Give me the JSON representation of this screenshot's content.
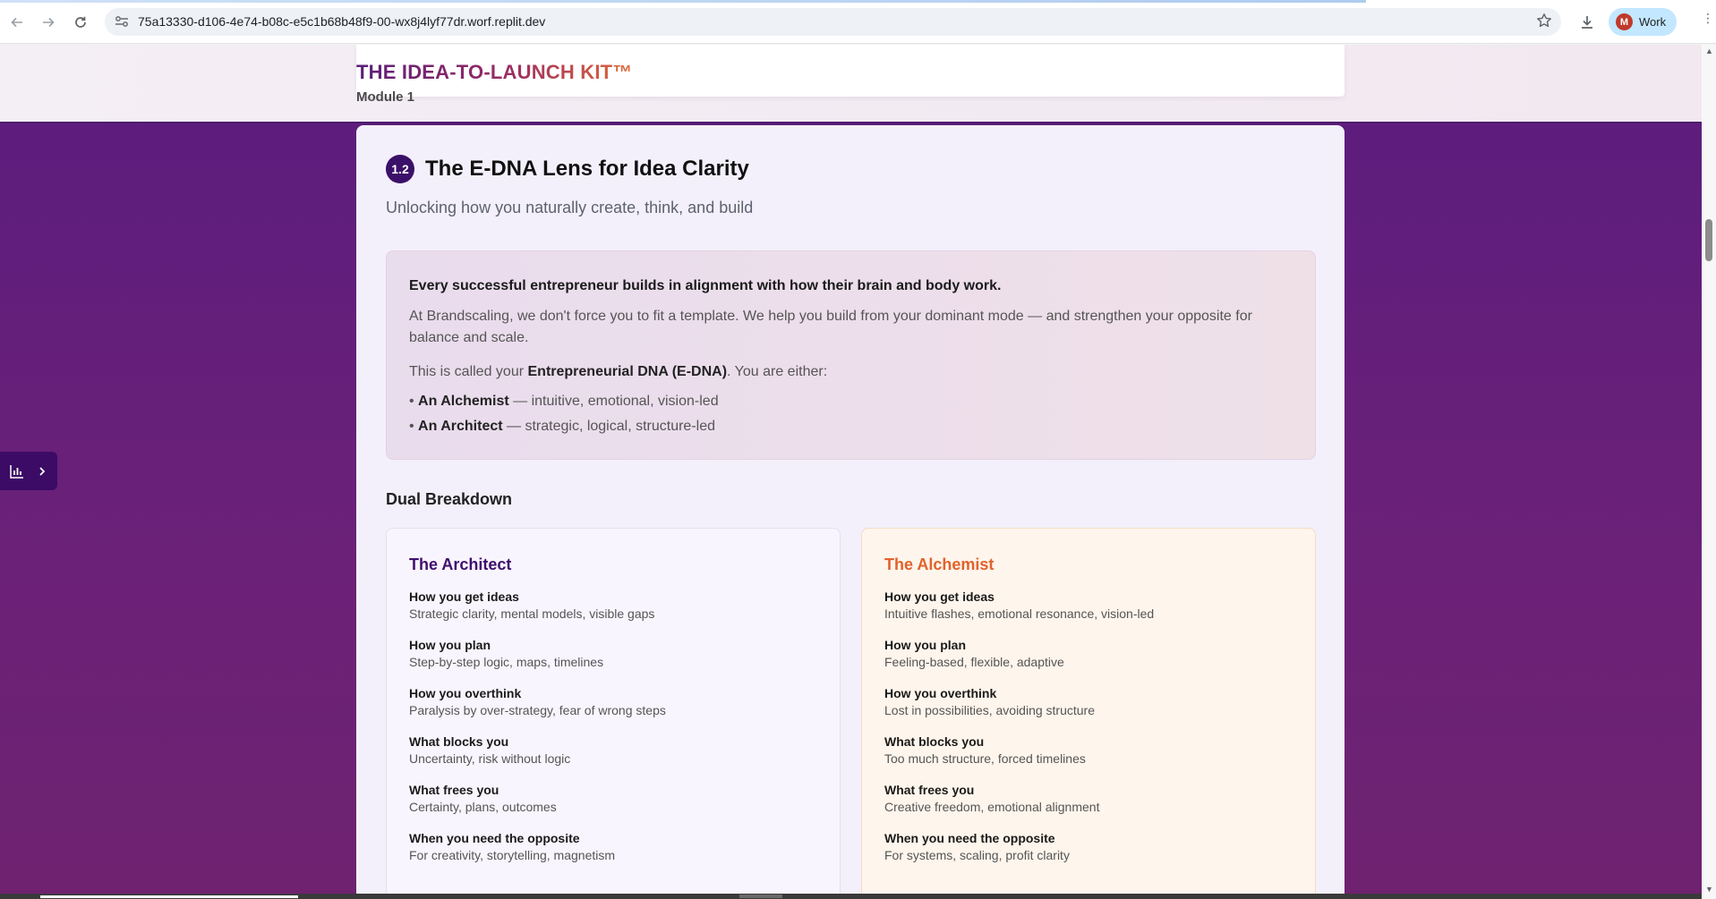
{
  "browser": {
    "url": "75a13330-d106-4e74-b08c-e5c1b68b48f9-00-wx8j4lyf77dr.worf.replit.dev",
    "profile_initial": "M",
    "profile_name": "Work"
  },
  "header": {
    "title": "THE IDEA-TO-LAUNCH KIT™",
    "module": "Module 1"
  },
  "section": {
    "number": "1.2",
    "title": "The E-DNA Lens for Idea Clarity",
    "subtitle": "Unlocking how you naturally create, think, and build"
  },
  "intro": {
    "lead": "Every successful entrepreneur builds in alignment with how their brain and body work.",
    "paragraph": "At Brandscaling, we don't force you to fit a template. We help you build from your dominant mode — and strengthen your opposite for balance and scale.",
    "edna_prefix": "This is called your ",
    "edna_bold": "Entrepreneurial DNA (E-DNA)",
    "edna_suffix": ". You are either:",
    "list": [
      {
        "bullet": "• ",
        "name": "An Alchemist",
        "desc": " — intuitive, emotional, vision-led"
      },
      {
        "bullet": "• ",
        "name": "An Architect",
        "desc": " — strategic, logical, structure-led"
      }
    ]
  },
  "dual": {
    "heading": "Dual Breakdown",
    "architect": {
      "title": "The Architect",
      "rows": [
        {
          "label": "How you get ideas",
          "value": "Strategic clarity, mental models, visible gaps"
        },
        {
          "label": "How you plan",
          "value": "Step-by-step logic, maps, timelines"
        },
        {
          "label": "How you overthink",
          "value": "Paralysis by over-strategy, fear of wrong steps"
        },
        {
          "label": "What blocks you",
          "value": "Uncertainty, risk without logic"
        },
        {
          "label": "What frees you",
          "value": "Certainty, plans, outcomes"
        },
        {
          "label": "When you need the opposite",
          "value": "For creativity, storytelling, magnetism"
        }
      ]
    },
    "alchemist": {
      "title": "The Alchemist",
      "rows": [
        {
          "label": "How you get ideas",
          "value": "Intuitive flashes, emotional resonance, vision-led"
        },
        {
          "label": "How you plan",
          "value": "Feeling-based, flexible, adaptive"
        },
        {
          "label": "How you overthink",
          "value": "Lost in possibilities, avoiding structure"
        },
        {
          "label": "What blocks you",
          "value": "Too much structure, forced timelines"
        },
        {
          "label": "What frees you",
          "value": "Creative freedom, emotional alignment"
        },
        {
          "label": "When you need the opposite",
          "value": "For systems, scaling, profit clarity"
        }
      ]
    }
  },
  "colors": {
    "page_bg": "#5b1c7e",
    "architect_accent": "#3f0f6e",
    "alchemist_accent": "#e2622c"
  }
}
